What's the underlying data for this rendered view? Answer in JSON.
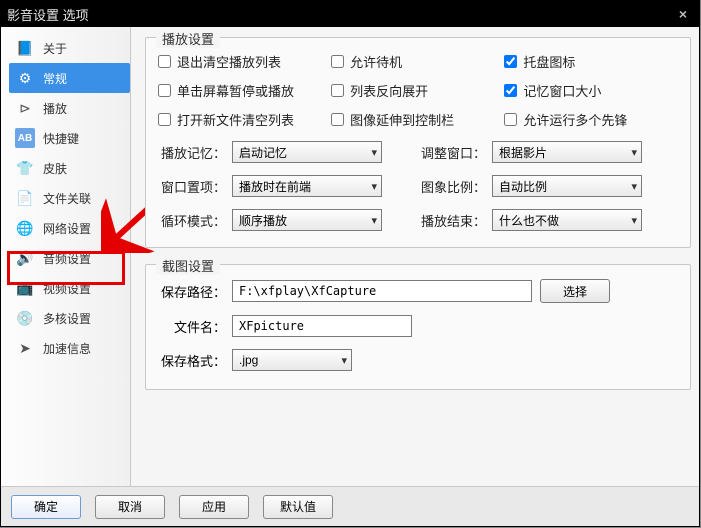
{
  "window": {
    "title": "影音设置 选项"
  },
  "sidebar": {
    "items": [
      {
        "icon": "📘",
        "label": "关于"
      },
      {
        "icon": "⚙",
        "label": "常规"
      },
      {
        "icon": "⊳",
        "label": "播放"
      },
      {
        "icon": "AB",
        "label": "快捷键"
      },
      {
        "icon": "👕",
        "label": "皮肤"
      },
      {
        "icon": "📄",
        "label": "文件关联"
      },
      {
        "icon": "🌐",
        "label": "网络设置"
      },
      {
        "icon": "🔊",
        "label": "音频设置"
      },
      {
        "icon": "📺",
        "label": "视频设置"
      },
      {
        "icon": "💿",
        "label": "多核设置"
      },
      {
        "icon": "➤",
        "label": "加速信息"
      }
    ]
  },
  "play_group": {
    "title": "播放设置",
    "checks": [
      [
        {
          "label": "退出清空播放列表",
          "checked": false
        },
        {
          "label": "允许待机",
          "checked": false
        },
        {
          "label": "托盘图标",
          "checked": true
        }
      ],
      [
        {
          "label": "单击屏幕暂停或播放",
          "checked": false
        },
        {
          "label": "列表反向展开",
          "checked": false
        },
        {
          "label": "记忆窗口大小",
          "checked": true
        }
      ],
      [
        {
          "label": "打开新文件清空列表",
          "checked": false
        },
        {
          "label": "图像延伸到控制栏",
          "checked": false
        },
        {
          "label": "允许运行多个先锋",
          "checked": false
        }
      ]
    ],
    "combos": [
      [
        {
          "label": "播放记忆：",
          "value": "启动记忆"
        },
        {
          "label": "调整窗口：",
          "value": "根据影片"
        }
      ],
      [
        {
          "label": "窗口置项：",
          "value": "播放时在前端"
        },
        {
          "label": "图象比例：",
          "value": "自动比例"
        }
      ],
      [
        {
          "label": "循环模式：",
          "value": "顺序播放"
        },
        {
          "label": "播放结束：",
          "value": "什么也不做"
        }
      ]
    ]
  },
  "shot_group": {
    "title": "截图设置",
    "path_label": "保存路径：",
    "path_value": "F:\\xfplay\\XfCapture",
    "browse_label": "选择",
    "name_label": "文件名：",
    "name_value": "XFpicture",
    "fmt_label": "保存格式：",
    "fmt_value": ".jpg"
  },
  "footer": {
    "ok": "确定",
    "cancel": "取消",
    "apply": "应用",
    "default": "默认值"
  }
}
